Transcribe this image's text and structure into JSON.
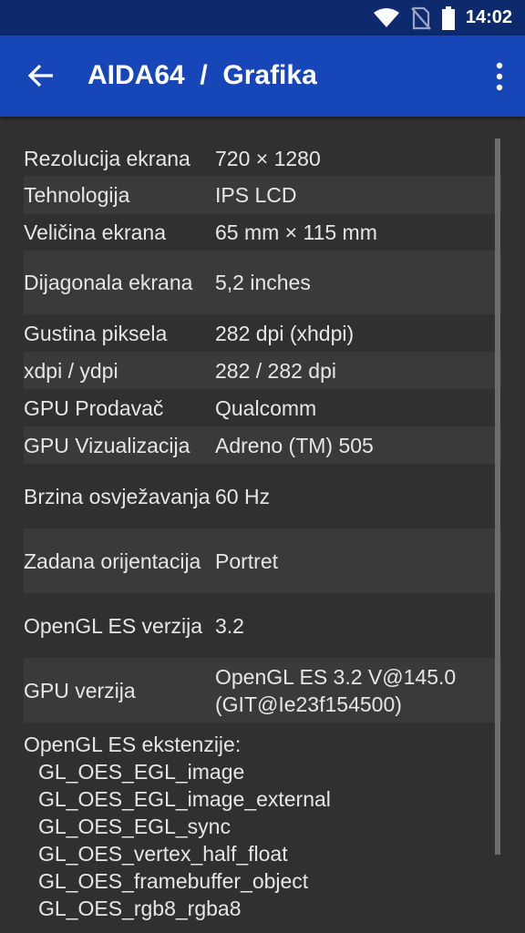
{
  "status_bar": {
    "time": "14:02"
  },
  "app_bar": {
    "title": "AIDA64  /  Grafika"
  },
  "rows": [
    {
      "label": "Rezolucija ekrana",
      "value": "720 × 1280"
    },
    {
      "label": "Tehnologija",
      "value": "IPS LCD"
    },
    {
      "label": "Veličina ekrana",
      "value": "65 mm × 115 mm"
    },
    {
      "label": "Dijagonala ekrana",
      "value": "5,2 inches"
    },
    {
      "label": "Gustina piksela",
      "value": "282 dpi (xhdpi)"
    },
    {
      "label": "xdpi / ydpi",
      "value": "282 / 282 dpi"
    },
    {
      "label": "GPU Prodavač",
      "value": "Qualcomm"
    },
    {
      "label": "GPU Vizualizacija",
      "value": "Adreno (TM) 505"
    },
    {
      "label": "Brzina osvježavanja",
      "value": "60 Hz"
    },
    {
      "label": "Zadana orijentacija",
      "value": "Portret"
    },
    {
      "label": "OpenGL ES verzija",
      "value": "3.2"
    },
    {
      "label": "GPU verzija",
      "value": "OpenGL ES 3.2 V@145.0 (GIT@Ie23f154500)"
    }
  ],
  "extensions": {
    "heading": "OpenGL ES ekstenzije:",
    "items": [
      "GL_OES_EGL_image",
      "GL_OES_EGL_image_external",
      "GL_OES_EGL_sync",
      "GL_OES_vertex_half_float",
      "GL_OES_framebuffer_object",
      "GL_OES_rgb8_rgba8"
    ]
  }
}
